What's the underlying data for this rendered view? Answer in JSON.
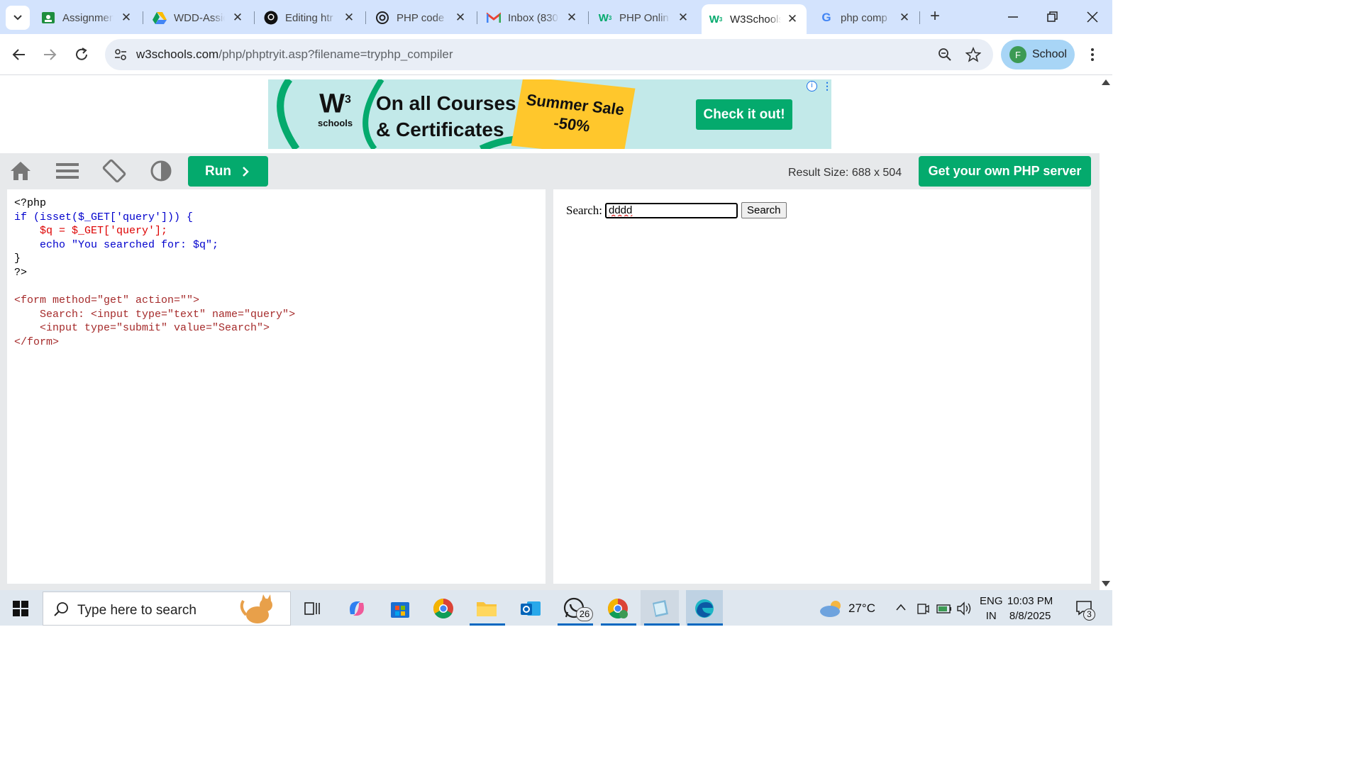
{
  "browser": {
    "tabs": [
      {
        "title": "Assignmen",
        "icon": "classroom-icon",
        "active": false
      },
      {
        "title": "WDD-Assic",
        "icon": "google-drive-icon",
        "active": false
      },
      {
        "title": "Editing htr",
        "icon": "github-icon",
        "active": false
      },
      {
        "title": "PHP code",
        "icon": "chatgpt-icon",
        "active": false
      },
      {
        "title": "Inbox (830",
        "icon": "gmail-icon",
        "active": false
      },
      {
        "title": "PHP Onlin",
        "icon": "w3schools-icon",
        "active": false
      },
      {
        "title": "W3Schools",
        "icon": "w3schools-icon",
        "active": true
      },
      {
        "title": "php comp",
        "icon": "google-icon",
        "active": false
      }
    ],
    "url_host": "w3schools.com",
    "url_path": "/php/phptryit.asp?filename=tryphp_compiler",
    "profile_initial": "F",
    "profile_label": "School"
  },
  "ad": {
    "logo_text": "schools",
    "headline_1": "On all Courses",
    "headline_2": "& Certificates",
    "sale_1": "Summer Sale",
    "sale_2": "-50%",
    "cta": "Check it out!"
  },
  "w3bar": {
    "run_label": "Run",
    "result_size": "Result Size: 688 x 504",
    "get_server": "Get your own PHP server"
  },
  "editor": {
    "lines": [
      "<?php",
      "if (isset($_GET['query'])) {",
      "    $q = $_GET['query'];",
      "    echo \"You searched for: $q\";",
      "}",
      "?>",
      "",
      "<form method=\"get\" action=\"\">",
      "    Search: <input type=\"text\" name=\"query\">",
      "    <input type=\"submit\" value=\"Search\">",
      "</form>"
    ]
  },
  "result": {
    "search_label": "Search:",
    "query_value": "dddd",
    "submit_label": "Search"
  },
  "taskbar": {
    "search_placeholder": "Type here to search",
    "whatsapp_badge": "26",
    "weather": "27°C",
    "lang_1": "ENG",
    "lang_2": "IN",
    "time": "10:03 PM",
    "date": "8/8/2025",
    "notif_count": "3"
  },
  "colors": {
    "accent": "#04aa6d",
    "tabstrip": "#d3e3fd"
  }
}
